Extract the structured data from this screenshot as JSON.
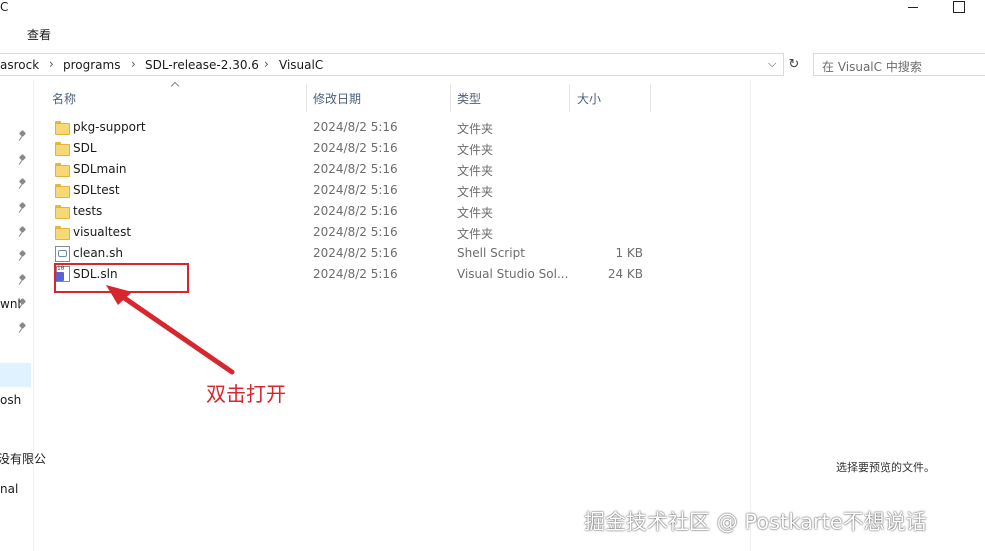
{
  "window": {
    "title_fragment": "C",
    "minimize_glyph": "",
    "maximize_glyph": ""
  },
  "ribbon": {
    "tabs": [
      {
        "label": "查看"
      }
    ]
  },
  "address_bar": {
    "breadcrumbs": [
      {
        "label": "asrock"
      },
      {
        "label": "programs"
      },
      {
        "label": "SDL-release-2.30.6"
      },
      {
        "label": "VisualC"
      }
    ],
    "separator": "›",
    "dropdown_icon": "chevron-down-icon",
    "dropdown_glyph": "⌵",
    "refresh_icon": "refresh-icon",
    "refresh_glyph": "↻"
  },
  "search": {
    "placeholder": "在 VisualC 中搜索"
  },
  "nav_pane": {
    "pinned_count": 9,
    "fragments": [
      {
        "label": "wnl"
      },
      {
        "label": "osh"
      },
      {
        "label": "没有限公"
      },
      {
        "label": "nal"
      }
    ]
  },
  "columns": [
    {
      "label": "名称"
    },
    {
      "label": "修改日期"
    },
    {
      "label": "类型"
    },
    {
      "label": "大小"
    }
  ],
  "files": [
    {
      "name": "pkg-support",
      "date": "2024/8/2 5:16",
      "type": "文件夹",
      "size": "",
      "icon": "folder-icon"
    },
    {
      "name": "SDL",
      "date": "2024/8/2 5:16",
      "type": "文件夹",
      "size": "",
      "icon": "folder-icon"
    },
    {
      "name": "SDLmain",
      "date": "2024/8/2 5:16",
      "type": "文件夹",
      "size": "",
      "icon": "folder-icon"
    },
    {
      "name": "SDLtest",
      "date": "2024/8/2 5:16",
      "type": "文件夹",
      "size": "",
      "icon": "folder-icon"
    },
    {
      "name": "tests",
      "date": "2024/8/2 5:16",
      "type": "文件夹",
      "size": "",
      "icon": "folder-icon"
    },
    {
      "name": "visualtest",
      "date": "2024/8/2 5:16",
      "type": "文件夹",
      "size": "",
      "icon": "folder-icon"
    },
    {
      "name": "clean.sh",
      "date": "2024/8/2 5:16",
      "type": "Shell Script",
      "size": "1 KB",
      "icon": "shell-script-icon"
    },
    {
      "name": "SDL.sln",
      "date": "2024/8/2 5:16",
      "type": "Visual Studio Sol...",
      "size": "24 KB",
      "icon": "visual-studio-solution-icon",
      "icon_tag": "10"
    }
  ],
  "preview_pane": {
    "message": "选择要预览的文件。"
  },
  "annotation": {
    "text": "双击打开",
    "color": "#d7262e"
  },
  "watermark": {
    "text": "掘金技术社区 @ Postkarte不想说话"
  }
}
